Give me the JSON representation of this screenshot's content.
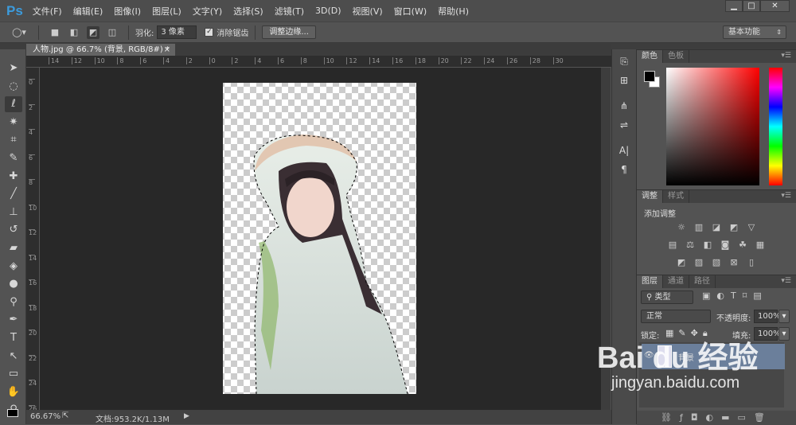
{
  "app": {
    "logo": "Ps",
    "menu": [
      "文件(F)",
      "编辑(E)",
      "图像(I)",
      "图层(L)",
      "文字(Y)",
      "选择(S)",
      "滤镜(T)",
      "3D(D)",
      "视图(V)",
      "窗口(W)",
      "帮助(H)"
    ],
    "window_buttons": {
      "minimize": "▁",
      "maximize": "□",
      "close": "✕"
    }
  },
  "options": {
    "feather_label": "羽化:",
    "feather_value": "3 像素",
    "antialias_label": "消除锯齿",
    "antialias_checked": true,
    "refine_edge": "调整边缘...",
    "workspace": "基本功能"
  },
  "document": {
    "tab_title": "人物.jpg @ 66.7% (背景, RGB/8#) *",
    "close": "×",
    "ruler_top": [
      "14",
      "12",
      "10",
      "8",
      "6",
      "4",
      "2",
      "0",
      "2",
      "4",
      "6",
      "8",
      "10",
      "12",
      "14",
      "16",
      "18",
      "20",
      "22",
      "24",
      "26",
      "28",
      "30"
    ],
    "ruler_left": [
      "0",
      "2",
      "4",
      "6",
      "8",
      "10",
      "12",
      "14",
      "16",
      "18",
      "20",
      "22",
      "24",
      "26"
    ]
  },
  "status": {
    "zoom": "66.67%",
    "doc_info": "文档:953.2K/1.13M"
  },
  "panels": {
    "color": {
      "tabs": [
        "颜色",
        "色板"
      ],
      "foreground": "#000000",
      "background": "#ffffff",
      "hue": "#ff0000"
    },
    "adjustments": {
      "tabs": [
        "调整",
        "样式"
      ],
      "title": "添加调整"
    },
    "layers": {
      "tabs": [
        "图层",
        "通道",
        "路径"
      ],
      "filter": "类型",
      "blend_mode": "正常",
      "opacity_label": "不透明度:",
      "opacity": "100%",
      "lock_label": "锁定:",
      "fill_label": "填充:",
      "fill": "100%",
      "items": [
        {
          "name": "背景",
          "visible": true,
          "selected": true
        }
      ]
    }
  },
  "watermark": {
    "brand": "Bai du 经验",
    "url": "jingyan.baidu.com"
  }
}
